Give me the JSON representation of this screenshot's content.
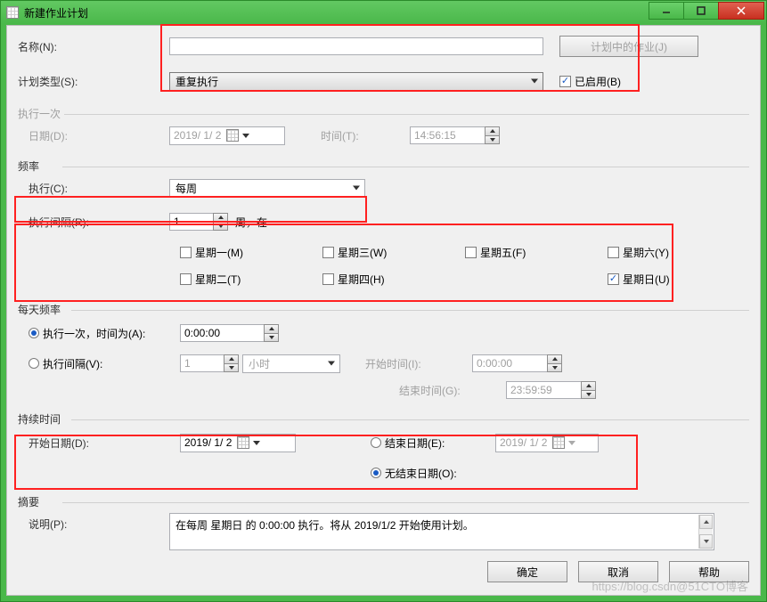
{
  "window": {
    "title": "新建作业计划"
  },
  "top": {
    "name_label": "名称(N):",
    "name_value": "",
    "jobs_button": "计划中的作业(J)",
    "type_label": "计划类型(S):",
    "type_value": "重复执行",
    "enabled_label": "已启用(B)"
  },
  "once": {
    "section": "执行一次",
    "date_label": "日期(D):",
    "date_value": "2019/ 1/ 2",
    "time_label": "时间(T):",
    "time_value": "14:56:15"
  },
  "freq": {
    "section": "频率",
    "exec_label": "执行(C):",
    "exec_value": "每周",
    "interval_label": "执行间隔(R):",
    "interval_value": "1",
    "interval_suffix": "周，在",
    "mon": "星期一(M)",
    "tue": "星期二(T)",
    "wed": "星期三(W)",
    "thu": "星期四(H)",
    "fri": "星期五(F)",
    "sat": "星期六(Y)",
    "sun": "星期日(U)"
  },
  "daily": {
    "section": "每天频率",
    "once_label": "执行一次，时间为(A):",
    "once_value": "0:00:00",
    "interval_label": "执行间隔(V):",
    "interval_value": "1",
    "interval_unit": "小时",
    "start_label": "开始时间(I):",
    "start_value": "0:00:00",
    "end_label": "结束时间(G):",
    "end_value": "23:59:59"
  },
  "duration": {
    "section": "持续时间",
    "start_date_label": "开始日期(D):",
    "start_date_value": "2019/ 1/ 2",
    "end_date_label": "结束日期(E):",
    "end_date_value": "2019/ 1/ 2",
    "no_end_label": "无结束日期(O):"
  },
  "summary": {
    "section": "摘要",
    "desc_label": "说明(P):",
    "desc_value": "在每周 星期日 的 0:00:00 执行。将从 2019/1/2 开始使用计划。"
  },
  "footer": {
    "ok": "确定",
    "cancel": "取消",
    "help": "帮助"
  },
  "watermark": "https://blog.csdn@51CTO博客"
}
